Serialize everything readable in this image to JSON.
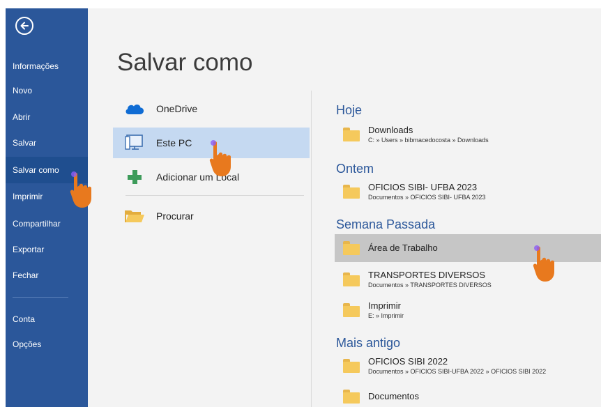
{
  "sidebar": {
    "items": [
      {
        "label": "Informações"
      },
      {
        "label": "Novo"
      },
      {
        "label": "Abrir"
      },
      {
        "label": "Salvar"
      },
      {
        "label": "Salvar como"
      },
      {
        "label": "Imprimir"
      },
      {
        "label": "Compartilhar"
      },
      {
        "label": "Exportar"
      },
      {
        "label": "Fechar"
      },
      {
        "label": "Conta"
      },
      {
        "label": "Opções"
      }
    ],
    "active_item": "Salvar como"
  },
  "page_title": "Salvar como",
  "locations": [
    {
      "label": "OneDrive",
      "icon": "cloud-icon"
    },
    {
      "label": "Este PC",
      "icon": "computer-icon",
      "selected": true
    },
    {
      "label": "Adicionar um Local",
      "icon": "plus-icon"
    },
    {
      "label": "Procurar",
      "icon": "open-folder-icon"
    }
  ],
  "sections": [
    {
      "title": "Hoje",
      "folders": [
        {
          "name": "Downloads",
          "path": "C: » Users » bibmacedocosta » Downloads"
        }
      ]
    },
    {
      "title": "Ontem",
      "folders": [
        {
          "name": "OFICIOS SIBI- UFBA 2023",
          "path": "Documentos » OFICIOS SIBI- UFBA 2023"
        }
      ]
    },
    {
      "title": "Semana Passada",
      "folders": [
        {
          "name": "Área de Trabalho",
          "path": ""
        },
        {
          "name": "TRANSPORTES DIVERSOS",
          "path": "Documentos » TRANSPORTES DIVERSOS"
        },
        {
          "name": "Imprimir",
          "path": "E: » Imprimir"
        }
      ]
    },
    {
      "title": "Mais antigo",
      "folders": [
        {
          "name": "OFICIOS SIBI 2022",
          "path": "Documentos » OFICIOS SIBI-UFBA 2022 » OFICIOS SIBI 2022"
        },
        {
          "name": "Documentos",
          "path": ""
        }
      ]
    }
  ],
  "colors": {
    "sidebar": "#2b579a",
    "accent": "#2b579a",
    "pointer": "#e8791e"
  }
}
